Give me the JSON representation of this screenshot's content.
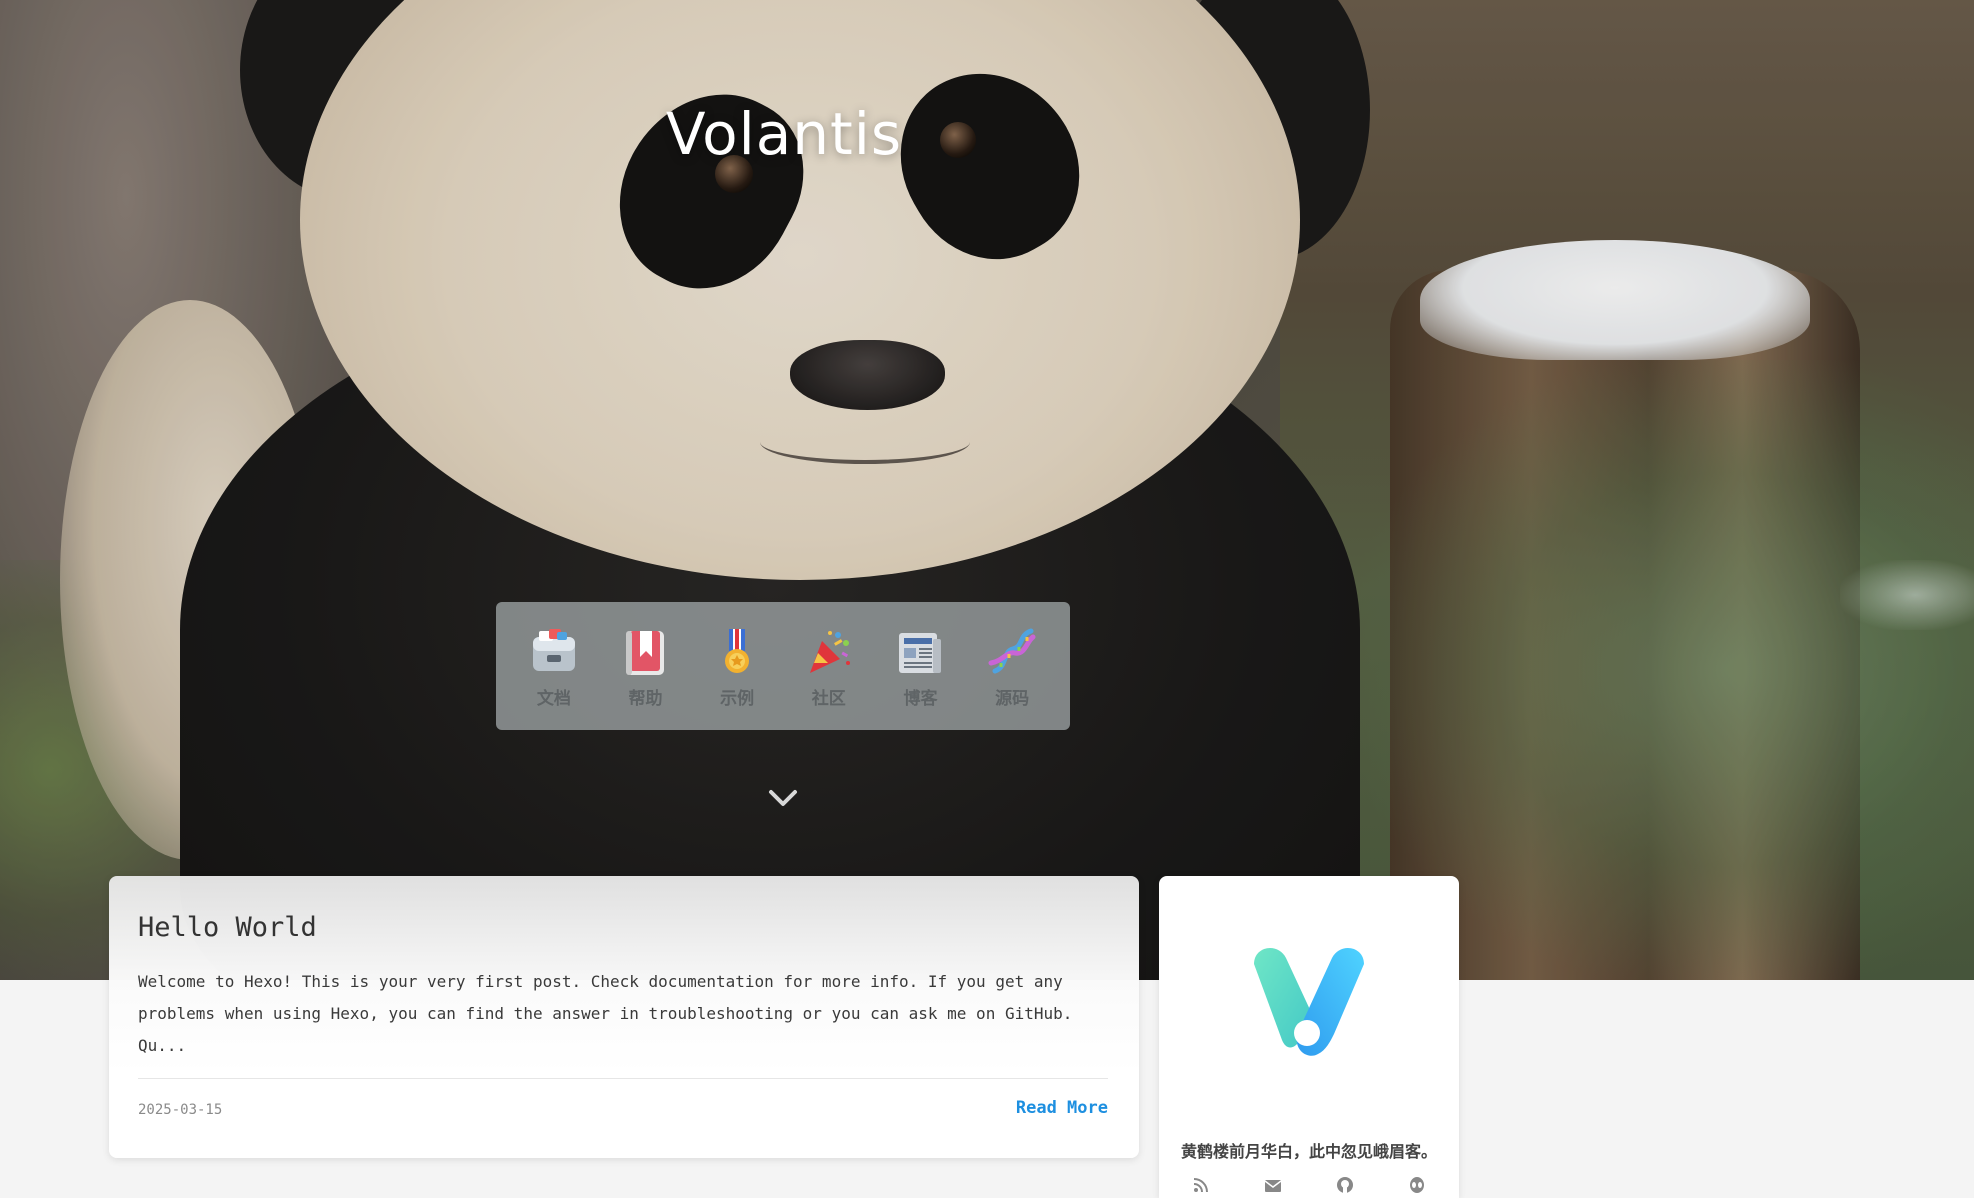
{
  "hero": {
    "title": "Volantis"
  },
  "menu": {
    "items": [
      {
        "label": "文档",
        "icon": "file-cabinet-icon"
      },
      {
        "label": "帮助",
        "icon": "bookmark-book-icon"
      },
      {
        "label": "示例",
        "icon": "medal-icon"
      },
      {
        "label": "社区",
        "icon": "party-popper-icon"
      },
      {
        "label": "博客",
        "icon": "newspaper-icon"
      },
      {
        "label": "源码",
        "icon": "dna-icon"
      }
    ]
  },
  "post": {
    "title": "Hello World",
    "excerpt": "Welcome to Hexo! This is your very first post. Check documentation for more info. If you get any problems when using Hexo, you can find the answer in troubleshooting or you can ask me on GitHub. Qu...",
    "date": "2025-03-15",
    "read_more": "Read More"
  },
  "sidebar": {
    "motto": "黄鹤楼前月华白，此中忽见峨眉客。",
    "social": [
      "rss-icon",
      "email-icon",
      "github-icon",
      "alien-icon"
    ]
  },
  "colors": {
    "accent": "#1d8fe0",
    "logo_cyan": "#5fe0c8",
    "logo_blue": "#39a9f5",
    "menu_bg": "#a8aeb0",
    "page_bg": "#f4f4f4"
  }
}
